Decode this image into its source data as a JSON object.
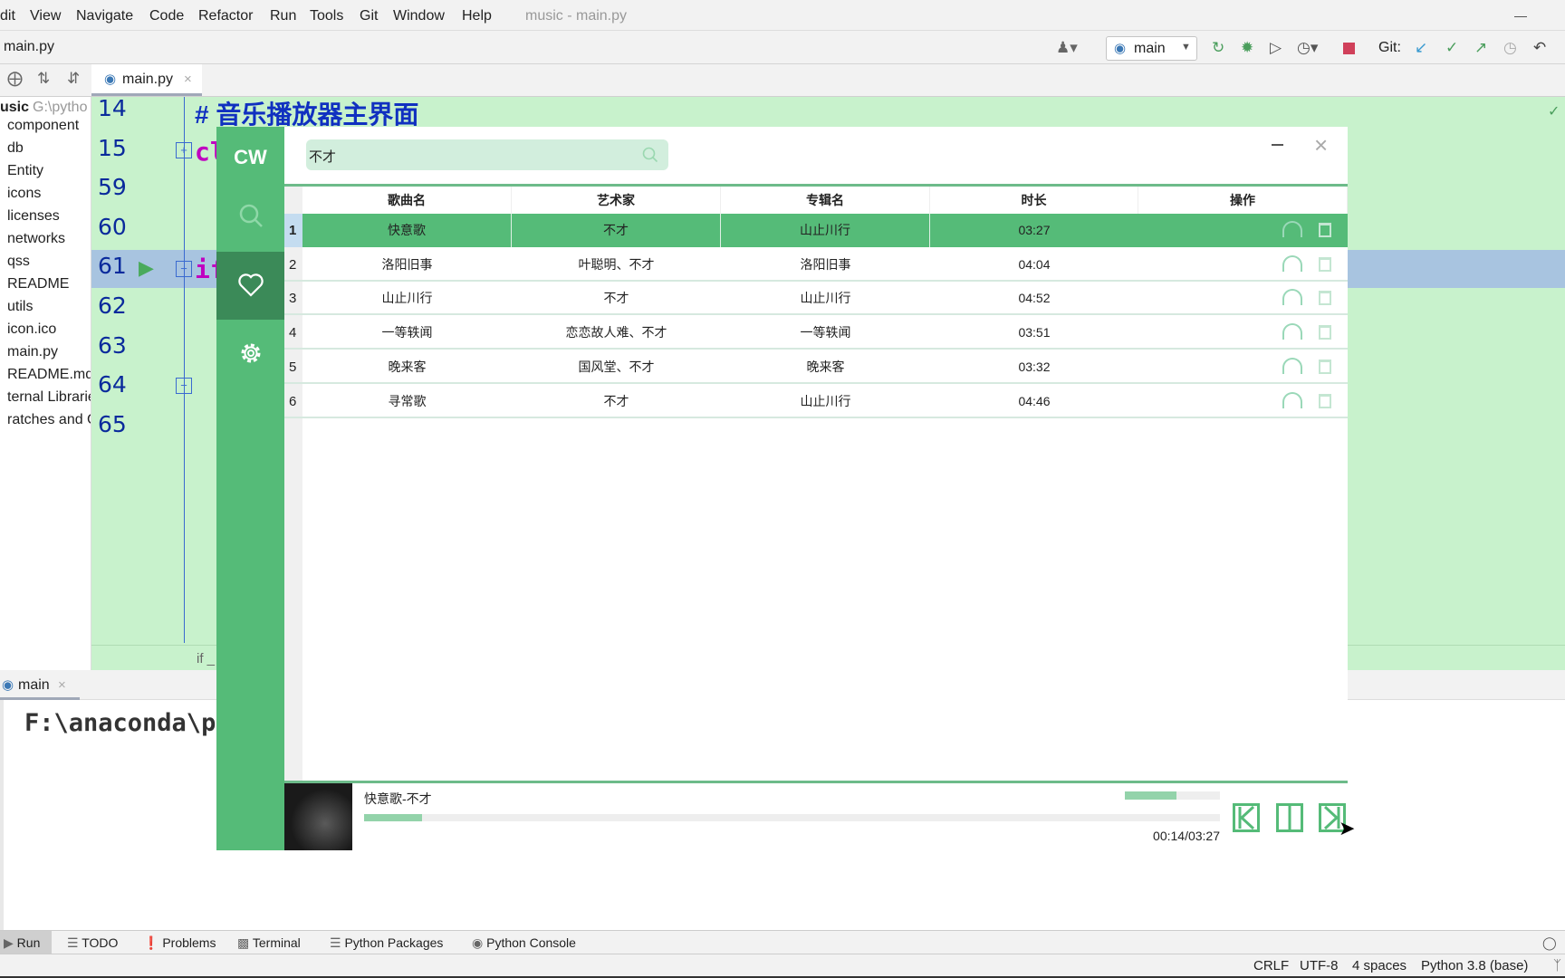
{
  "ide": {
    "menu": [
      "dit",
      "View",
      "Navigate",
      "Code",
      "Refactor",
      "Run",
      "Tools",
      "Git",
      "Window",
      "Help"
    ],
    "window_title": "music - main.py",
    "breadcrumb": "main.py",
    "run_config": "main",
    "git_label": "Git:",
    "editor_tab": "main.py",
    "project_root": "usic",
    "project_path": "G:\\pytho",
    "tree": [
      "component",
      "db",
      "Entity",
      "icons",
      "licenses",
      "networks",
      "qss",
      "README",
      "utils",
      "icon.ico",
      "main.py",
      "README.md",
      "ternal Librarie",
      "ratches and C"
    ],
    "line_numbers": [
      "14",
      "15",
      "59",
      "60",
      "61",
      "62",
      "63",
      "64",
      "65"
    ],
    "code_comment": "#  音乐播放器主界面",
    "code_line15": "cl",
    "code_line61": "if",
    "editor_breadcrumb": "if _",
    "run_tab": "main",
    "console_text": "F:\\anaconda\\py",
    "tool_tabs": [
      "Run",
      "TODO",
      "Problems",
      "Terminal",
      "Python Packages",
      "Python Console"
    ],
    "status": [
      "CRLF",
      "UTF-8",
      "4 spaces",
      "Python 3.8 (base)"
    ]
  },
  "app": {
    "logo": "CW",
    "nav": [
      "search-icon",
      "heart-icon",
      "gear-icon"
    ],
    "active_nav": "favorites",
    "search_value": "不才",
    "columns": [
      "歌曲名",
      "艺术家",
      "专辑名",
      "时长",
      "操作"
    ],
    "rows": [
      {
        "no": "1",
        "title": "快意歌",
        "artist": "不才",
        "album": "山止川行",
        "duration": "03:27"
      },
      {
        "no": "2",
        "title": "洛阳旧事",
        "artist": "叶聪明、不才",
        "album": "洛阳旧事",
        "duration": "04:04"
      },
      {
        "no": "3",
        "title": "山止川行",
        "artist": "不才",
        "album": "山止川行",
        "duration": "04:52"
      },
      {
        "no": "4",
        "title": "一等轶闻",
        "artist": "恋恋故人难、不才",
        "album": "一等轶闻",
        "duration": "03:51"
      },
      {
        "no": "5",
        "title": "晚来客",
        "artist": "国风堂、不才",
        "album": "晚来客",
        "duration": "03:32"
      },
      {
        "no": "6",
        "title": "寻常歌",
        "artist": "不才",
        "album": "山止川行",
        "duration": "04:46"
      }
    ],
    "selected_row": 1,
    "player": {
      "now_playing": "快意歌-不才",
      "time": "00:14/03:27",
      "progress": 0.068,
      "volume": 0.54
    },
    "colors": {
      "accent": "#55bb78",
      "accent_dark": "#3b8a58",
      "search_bg": "#d2eedd"
    }
  }
}
